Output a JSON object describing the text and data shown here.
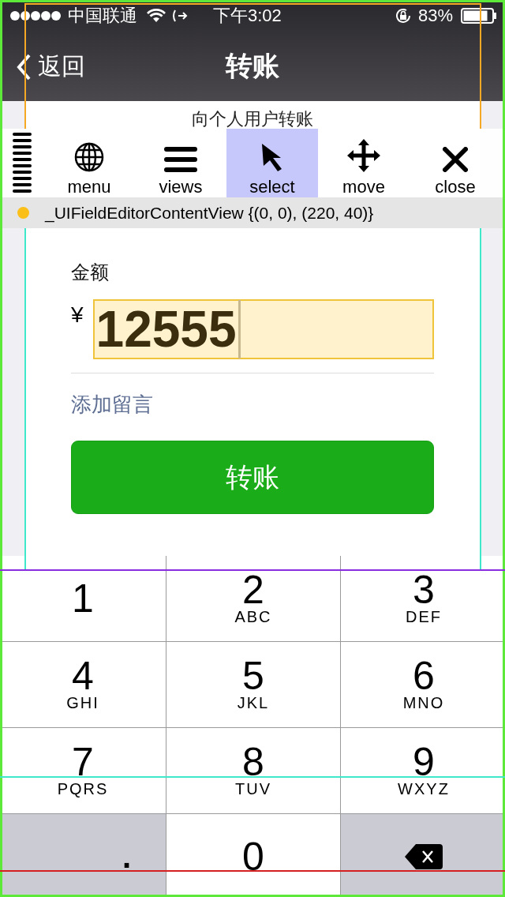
{
  "status_bar": {
    "carrier": "中国联通",
    "time": "下午3:02",
    "battery": "83%"
  },
  "nav_bar": {
    "back": "返回",
    "title": "转账"
  },
  "heading": "向个人用户转账",
  "flex_toolbar": {
    "items": [
      {
        "label": "menu",
        "kind": "globe",
        "selected": false
      },
      {
        "label": "views",
        "kind": "lines",
        "selected": false
      },
      {
        "label": "select",
        "kind": "pointer",
        "selected": true
      },
      {
        "label": "move",
        "kind": "arrows",
        "selected": false
      },
      {
        "label": "close",
        "kind": "cross",
        "selected": false
      }
    ],
    "selection": "_UIFieldEditorContentView {(0, 0), (220, 40)}"
  },
  "form": {
    "amount_label": "金额",
    "currency": "¥",
    "amount": "12555",
    "memo_link": "添加留言",
    "submit": "转账"
  },
  "keypad": [
    {
      "kind": "digit",
      "digit": "1"
    },
    {
      "kind": "digit",
      "digit": "2",
      "letters": "ABC"
    },
    {
      "kind": "digit",
      "digit": "3",
      "letters": "DEF"
    },
    {
      "kind": "digit",
      "digit": "4",
      "letters": "GHI"
    },
    {
      "kind": "digit",
      "digit": "5",
      "letters": "JKL"
    },
    {
      "kind": "digit",
      "digit": "6",
      "letters": "MNO"
    },
    {
      "kind": "digit",
      "digit": "7",
      "letters": "PQRS"
    },
    {
      "kind": "digit",
      "digit": "8",
      "letters": "TUV"
    },
    {
      "kind": "digit",
      "digit": "9",
      "letters": "WXYZ"
    },
    {
      "kind": "decimal",
      "digit": "."
    },
    {
      "kind": "digit",
      "digit": "0"
    },
    {
      "kind": "delete"
    }
  ]
}
